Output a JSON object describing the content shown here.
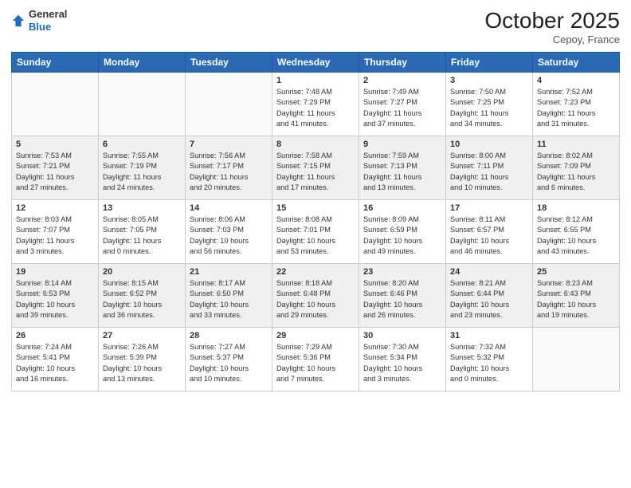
{
  "logo": {
    "general": "General",
    "blue": "Blue"
  },
  "header": {
    "month": "October 2025",
    "location": "Cepoy, France"
  },
  "weekdays": [
    "Sunday",
    "Monday",
    "Tuesday",
    "Wednesday",
    "Thursday",
    "Friday",
    "Saturday"
  ],
  "weeks": [
    [
      {
        "day": "",
        "info": ""
      },
      {
        "day": "",
        "info": ""
      },
      {
        "day": "",
        "info": ""
      },
      {
        "day": "1",
        "info": "Sunrise: 7:48 AM\nSunset: 7:29 PM\nDaylight: 11 hours\nand 41 minutes."
      },
      {
        "day": "2",
        "info": "Sunrise: 7:49 AM\nSunset: 7:27 PM\nDaylight: 11 hours\nand 37 minutes."
      },
      {
        "day": "3",
        "info": "Sunrise: 7:50 AM\nSunset: 7:25 PM\nDaylight: 11 hours\nand 34 minutes."
      },
      {
        "day": "4",
        "info": "Sunrise: 7:52 AM\nSunset: 7:23 PM\nDaylight: 11 hours\nand 31 minutes."
      }
    ],
    [
      {
        "day": "5",
        "info": "Sunrise: 7:53 AM\nSunset: 7:21 PM\nDaylight: 11 hours\nand 27 minutes."
      },
      {
        "day": "6",
        "info": "Sunrise: 7:55 AM\nSunset: 7:19 PM\nDaylight: 11 hours\nand 24 minutes."
      },
      {
        "day": "7",
        "info": "Sunrise: 7:56 AM\nSunset: 7:17 PM\nDaylight: 11 hours\nand 20 minutes."
      },
      {
        "day": "8",
        "info": "Sunrise: 7:58 AM\nSunset: 7:15 PM\nDaylight: 11 hours\nand 17 minutes."
      },
      {
        "day": "9",
        "info": "Sunrise: 7:59 AM\nSunset: 7:13 PM\nDaylight: 11 hours\nand 13 minutes."
      },
      {
        "day": "10",
        "info": "Sunrise: 8:00 AM\nSunset: 7:11 PM\nDaylight: 11 hours\nand 10 minutes."
      },
      {
        "day": "11",
        "info": "Sunrise: 8:02 AM\nSunset: 7:09 PM\nDaylight: 11 hours\nand 6 minutes."
      }
    ],
    [
      {
        "day": "12",
        "info": "Sunrise: 8:03 AM\nSunset: 7:07 PM\nDaylight: 11 hours\nand 3 minutes."
      },
      {
        "day": "13",
        "info": "Sunrise: 8:05 AM\nSunset: 7:05 PM\nDaylight: 11 hours\nand 0 minutes."
      },
      {
        "day": "14",
        "info": "Sunrise: 8:06 AM\nSunset: 7:03 PM\nDaylight: 10 hours\nand 56 minutes."
      },
      {
        "day": "15",
        "info": "Sunrise: 8:08 AM\nSunset: 7:01 PM\nDaylight: 10 hours\nand 53 minutes."
      },
      {
        "day": "16",
        "info": "Sunrise: 8:09 AM\nSunset: 6:59 PM\nDaylight: 10 hours\nand 49 minutes."
      },
      {
        "day": "17",
        "info": "Sunrise: 8:11 AM\nSunset: 6:57 PM\nDaylight: 10 hours\nand 46 minutes."
      },
      {
        "day": "18",
        "info": "Sunrise: 8:12 AM\nSunset: 6:55 PM\nDaylight: 10 hours\nand 43 minutes."
      }
    ],
    [
      {
        "day": "19",
        "info": "Sunrise: 8:14 AM\nSunset: 6:53 PM\nDaylight: 10 hours\nand 39 minutes."
      },
      {
        "day": "20",
        "info": "Sunrise: 8:15 AM\nSunset: 6:52 PM\nDaylight: 10 hours\nand 36 minutes."
      },
      {
        "day": "21",
        "info": "Sunrise: 8:17 AM\nSunset: 6:50 PM\nDaylight: 10 hours\nand 33 minutes."
      },
      {
        "day": "22",
        "info": "Sunrise: 8:18 AM\nSunset: 6:48 PM\nDaylight: 10 hours\nand 29 minutes."
      },
      {
        "day": "23",
        "info": "Sunrise: 8:20 AM\nSunset: 6:46 PM\nDaylight: 10 hours\nand 26 minutes."
      },
      {
        "day": "24",
        "info": "Sunrise: 8:21 AM\nSunset: 6:44 PM\nDaylight: 10 hours\nand 23 minutes."
      },
      {
        "day": "25",
        "info": "Sunrise: 8:23 AM\nSunset: 6:43 PM\nDaylight: 10 hours\nand 19 minutes."
      }
    ],
    [
      {
        "day": "26",
        "info": "Sunrise: 7:24 AM\nSunset: 5:41 PM\nDaylight: 10 hours\nand 16 minutes."
      },
      {
        "day": "27",
        "info": "Sunrise: 7:26 AM\nSunset: 5:39 PM\nDaylight: 10 hours\nand 13 minutes."
      },
      {
        "day": "28",
        "info": "Sunrise: 7:27 AM\nSunset: 5:37 PM\nDaylight: 10 hours\nand 10 minutes."
      },
      {
        "day": "29",
        "info": "Sunrise: 7:29 AM\nSunset: 5:36 PM\nDaylight: 10 hours\nand 7 minutes."
      },
      {
        "day": "30",
        "info": "Sunrise: 7:30 AM\nSunset: 5:34 PM\nDaylight: 10 hours\nand 3 minutes."
      },
      {
        "day": "31",
        "info": "Sunrise: 7:32 AM\nSunset: 5:32 PM\nDaylight: 10 hours\nand 0 minutes."
      },
      {
        "day": "",
        "info": ""
      }
    ]
  ]
}
